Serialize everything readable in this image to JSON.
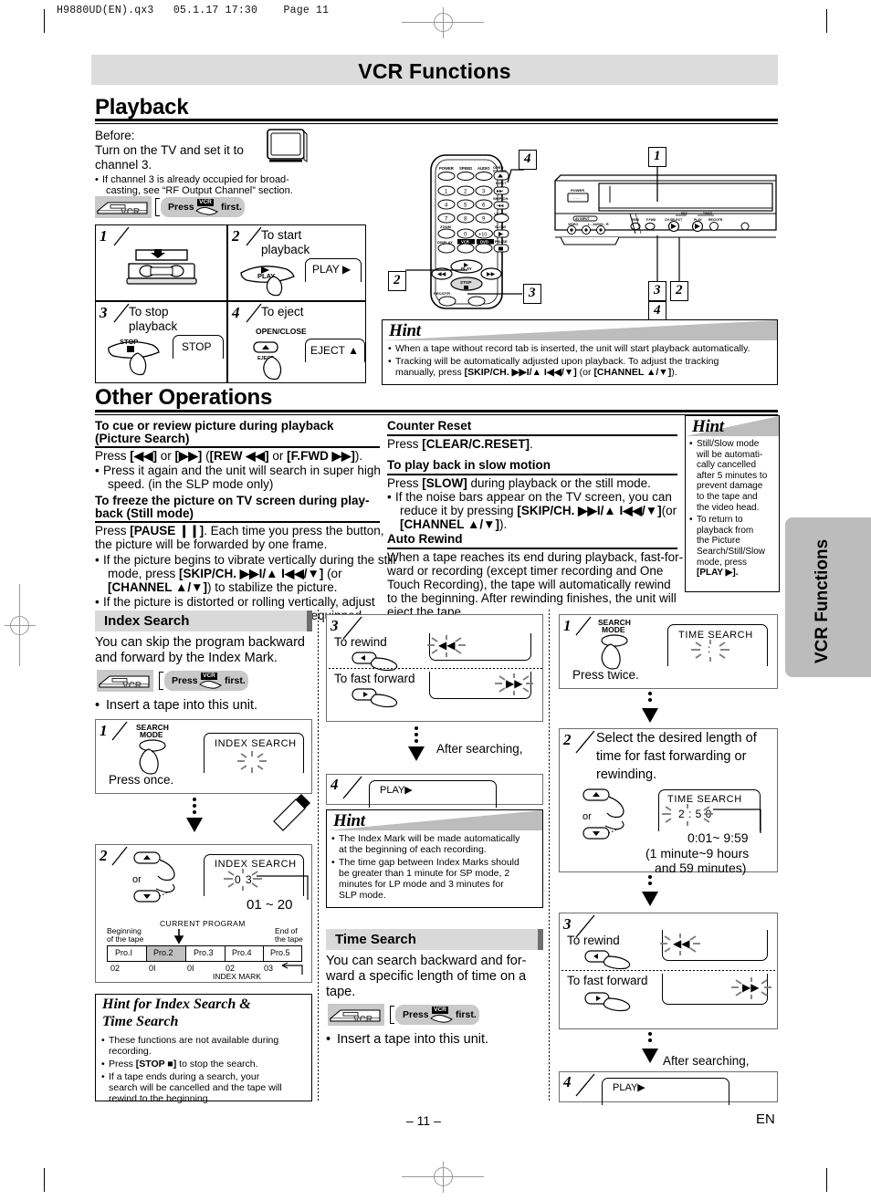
{
  "file_header": "H9880UD(EN).qx3   05.1.17 17:30    Page 11",
  "chapter_banner": "VCR Functions",
  "side_tab": "VCR Functions",
  "footer": {
    "page": "– 11 –",
    "lang": "EN"
  },
  "playback": {
    "title": "Playback",
    "before_label": "Before:",
    "before_line1": "Turn on the TV and set it to",
    "before_line2": "channel 3.",
    "before_bullet": "If channel 3 is already occupied for broad-casting, see “RF Output Channel” section.",
    "before_bullet_l1": "If channel 3 is already occupied for broad-",
    "before_bullet_l2": "casting, see “RF Output Channel” section.",
    "vcr_icon_label": "VCR",
    "press_first_pre": "Press",
    "press_first_key": "VCR",
    "press_first_post": "first.",
    "steps": [
      {
        "num": "1",
        "caption": "",
        "button": "",
        "display": ""
      },
      {
        "num": "2",
        "caption_l1": "To start",
        "caption_l2": "playback",
        "button": "PLAY",
        "display": "PLAY ▶"
      },
      {
        "num": "3",
        "caption_l1": "To stop",
        "caption_l2": "playback",
        "button": "STOP",
        "display": "STOP"
      },
      {
        "num": "4",
        "caption_l1": "To eject",
        "caption_l2": "",
        "button_top": "OPEN/CLOSE",
        "button_bottom": "EJECT",
        "display": "EJECT ▲"
      }
    ],
    "remote": {
      "rows": [
        [
          "POWER",
          "SPEED",
          "AUDIO"
        ],
        [
          "1",
          "2",
          "3"
        ],
        [
          "4",
          "5",
          "6"
        ],
        [
          "7",
          "8",
          "9"
        ],
        [
          "0",
          "+10"
        ]
      ],
      "labels": {
        "open_close": "OPEN/CLOSE",
        "eject": "EJECT",
        "skip_ch": "SKIP/CH.",
        "vcr_tv": "VCR/TV",
        "slow": "SLOW",
        "pause": "PAUSE",
        "zoom": "ZOOM",
        "display": "DISPLAY",
        "vcr": "VCR",
        "dvd": "DVD",
        "play": "PLAY",
        "stop": "STOP",
        "rec_otr": "REC/OTR"
      },
      "callouts": [
        "4",
        "2",
        "3"
      ]
    },
    "unit": {
      "labels": {
        "power": "POWER",
        "av_input": "AV INPUT",
        "video": "VIDEO",
        "audio": "L - AUDIO - R",
        "rew": "REW",
        "ffwd": "F.FWD",
        "ch_select": "CH.SELECT",
        "play": "PLAY",
        "rec": "REC/OTR",
        "rec_led": "REC",
        "timer_led": "TIMER"
      },
      "callouts": [
        "1",
        "3",
        "2",
        "4"
      ]
    },
    "hint": {
      "title": "Hint",
      "items": [
        "When a tape without record tab is inserted, the unit will start playback automatically.",
        "Tracking will be automatically adjusted upon playback. To adjust the tracking manually, press [SKIP/CH. ▶▶I/▲ I◀◀/▼] (or [CHANNEL ▲/▼])."
      ],
      "item2_l1": "Tracking will be automatically adjusted upon playback. To adjust the tracking",
      "item2_l2_a": "manually, press ",
      "item2_l2_b": "[SKIP/CH. ▶▶I/▲ I◀◀/▼]",
      "item2_l2_c": " (or ",
      "item2_l2_d": "[CHANNEL ▲/▼]",
      "item2_l2_e": ")."
    }
  },
  "other_operations": {
    "title": "Other Operations",
    "left": [
      {
        "heading_l1": "To cue or review picture during playback",
        "heading_l2": "(Picture Search)",
        "body_l1_a": "Press ",
        "body_l1_b": "[◀◀]",
        "body_l1_c": " or ",
        "body_l1_d": "[▶▶]",
        "body_l1_e": " (",
        "body_l1_f": "[REW ◀◀]",
        "body_l1_g": " or ",
        "body_l1_h": "[F.FWD ▶▶]",
        "body_l1_i": ").",
        "bullet_l1": "Press it again and the unit will search in super high",
        "bullet_l2": "speed. (in the SLP mode only)"
      },
      {
        "heading_l1": "To freeze the picture on TV screen during play-",
        "heading_l2": "back (Still mode)",
        "body_l1_a": "Press ",
        "body_l1_b": "[PAUSE ❙❙]",
        "body_l1_c": ". Each time you press the button,",
        "body_l2": "the picture will be forwarded by one frame.",
        "bullet1_l1": "If the picture begins to vibrate vertically during the still",
        "bullet1_l2_a": "mode, press ",
        "bullet1_l2_b": "[SKIP/CH. ▶▶I/▲ I◀◀/▼]",
        "bullet1_l2_c": " (or",
        "bullet1_l3_a": "[CHANNEL ▲/▼]",
        "bullet1_l3_b": ") to stabilize the picture.",
        "bullet2_l1": "If the picture is distorted or rolling vertically, adjust",
        "bullet2_l2": "the vertical hold control on your TV if equipped."
      }
    ],
    "middle": [
      {
        "heading": "Counter Reset",
        "body_a": "Press ",
        "body_b": "[CLEAR/C.RESET]",
        "body_c": "."
      },
      {
        "heading": "To play back in slow motion",
        "body_a": "Press ",
        "body_b": "[SLOW]",
        "body_c": " during playback or the still mode.",
        "bullet_l1": "If the noise bars appear on the TV screen, you can",
        "bullet_l2_a": "reduce it by pressing ",
        "bullet_l2_b": "[SKIP/CH. ▶▶I/▲ I◀◀/▼]",
        "bullet_l2_c": "(or",
        "bullet_l3_a": "[CHANNEL ▲/▼]",
        "bullet_l3_b": ")."
      },
      {
        "heading": "Auto Rewind",
        "body_l1": "When a tape reaches its end during playback, fast-for-",
        "body_l2": "ward or recording (except timer recording and One",
        "body_l3": "Touch Recording), the tape will automatically rewind",
        "body_l4": "to the beginning. After rewinding finishes, the unit will",
        "body_l5": "eject the tape."
      }
    ],
    "hint": {
      "title": "Hint",
      "item1_l1": "Still/Slow mode",
      "item1_l2": "will be automati-",
      "item1_l3": "cally cancelled",
      "item1_l4": "after 5 minutes to",
      "item1_l5": "prevent damage",
      "item1_l6": "to the tape and",
      "item1_l7": "the video head.",
      "item2_l1": "To return to",
      "item2_l2": "playback from",
      "item2_l3": "the Picture",
      "item2_l4": "Search/Still/Slow",
      "item2_l5": "mode, press",
      "item2_l6": "[PLAY ▶]."
    }
  },
  "index_search": {
    "title": "Index Search",
    "intro_l1": "You can skip the program backward",
    "intro_l2": "and forward by the Index Mark.",
    "press_first_pre": "Press",
    "press_first_key": "VCR",
    "press_first_post": "first.",
    "insert_note": "Insert a tape into this unit.",
    "step1": {
      "num": "1",
      "button_l1": "SEARCH",
      "button_l2": "MODE",
      "display": "INDEX SEARCH",
      "caption": "Press once."
    },
    "step2": {
      "num": "2",
      "or": "or",
      "up": "▲",
      "down": "▼",
      "display": "INDEX SEARCH",
      "display_value": "0 3",
      "range": "01 ~ 20",
      "current_program": "CURRENT PROGRAM",
      "beginning_l1": "Beginning",
      "beginning_l2": "of the tape",
      "end_l1": "End of",
      "end_l2": "the tape",
      "programs": [
        "Pro.I",
        "Pro.2",
        "Pro.3",
        "Pro.4",
        "Pro.5"
      ],
      "marks": [
        "02",
        "0I",
        "0I",
        "02",
        "03"
      ],
      "index_mark_label": "INDEX MARK"
    },
    "hint": {
      "title_l1": "Hint for Index Search &",
      "title_l2": "Time Search",
      "items": [
        "These functions are not available during recording.",
        "Press [STOP ■] to stop the search.",
        "If a tape ends during a search, your search will be cancelled and the tape will rewind to the beginning."
      ],
      "item1_l1": "These functions are not available during",
      "item1_l2": "recording.",
      "item2_a": "Press ",
      "item2_b": "[STOP ■]",
      "item2_c": " to stop the search.",
      "item3_l1": "If a tape ends during a search, your",
      "item3_l2": "search will be cancelled and the tape will",
      "item3_l3": "rewind to the beginning."
    },
    "step3": {
      "num": "3",
      "rewind_label": "To rewind",
      "ffwd_label": "To fast forward",
      "left_btn": "◀",
      "right_btn": "▶",
      "disp_rew": "◀◀",
      "disp_ffwd": "▶▶"
    },
    "after_searching": "After searching,",
    "step4": {
      "num": "4",
      "display": "PLAY▶"
    },
    "hint2": {
      "title": "Hint",
      "item1_l1": "The Index Mark will be made automatically",
      "item1_l2": "at the beginning of each recording.",
      "item2_l1": "The time gap between Index Marks should",
      "item2_l2": "be greater than 1 minute for SP mode, 2",
      "item2_l3": "minutes for LP mode and 3 minutes for",
      "item2_l4": "SLP mode."
    }
  },
  "time_search": {
    "title": "Time Search",
    "intro_l1": "You can search backward and for-",
    "intro_l2": "ward a specific length of time on a",
    "intro_l3": "tape.",
    "press_first_pre": "Press",
    "press_first_key": "VCR",
    "press_first_post": "first.",
    "insert_note": "Insert a tape into this unit.",
    "step1": {
      "num": "1",
      "button_l1": "SEARCH",
      "button_l2": "MODE",
      "display": "TIME SEARCH",
      "display_value": ":",
      "caption": "Press twice."
    },
    "step2": {
      "num": "2",
      "caption_l1": "Select the desired length of",
      "caption_l2": "time for fast forwarding or",
      "caption_l3": "rewinding.",
      "or": "or",
      "up": "▲",
      "down": "▼",
      "display": "TIME SEARCH",
      "display_value": "2 : 5 0",
      "range": "0:01~ 9:59",
      "range_note_l1": "(1 minute~9 hours",
      "range_note_l2": "and 59 minutes)"
    },
    "step3": {
      "num": "3",
      "rewind_label": "To rewind",
      "ffwd_label": "To fast forward",
      "left_btn": "◀",
      "right_btn": "▶",
      "disp_rew": "◀◀",
      "disp_ffwd": "▶▶"
    },
    "after_searching": "After searching,",
    "step4": {
      "num": "4",
      "display": "PLAY▶"
    }
  }
}
